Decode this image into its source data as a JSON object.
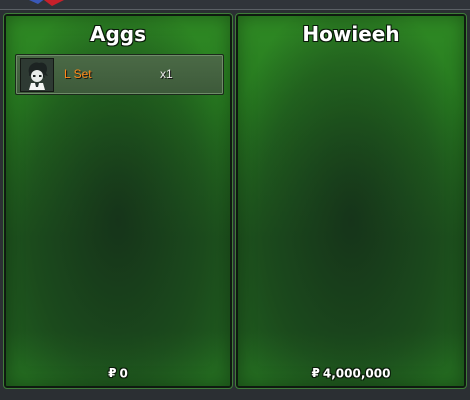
{
  "trade": {
    "left": {
      "player_name": "Aggs",
      "items": [
        {
          "icon": "character-avatar-icon",
          "name": "L Set",
          "quantity": "x1"
        }
      ],
      "currency_symbol": "₽",
      "money": "0"
    },
    "right": {
      "player_name": "Howieeh",
      "items": [],
      "currency_symbol": "₽",
      "money": "4,000,000"
    }
  },
  "colors": {
    "panel_green": "#277a20",
    "item_name": "#ff8a1a",
    "title_text": "#ffffff"
  }
}
